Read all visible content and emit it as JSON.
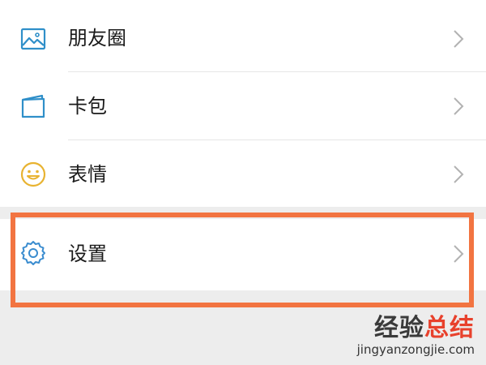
{
  "menu": {
    "items": [
      {
        "label": "朋友圈",
        "icon": "moments-picture-icon"
      },
      {
        "label": "卡包",
        "icon": "card-wallet-icon"
      },
      {
        "label": "表情",
        "icon": "smiley-emoji-icon"
      }
    ],
    "settings": {
      "label": "设置",
      "icon": "gear-icon"
    }
  },
  "highlight": {
    "color": "#f27441"
  },
  "watermark": {
    "logo_main": "经验",
    "logo_accent": "总结",
    "url": "jingyanzongjie.com"
  },
  "colors": {
    "icon_blue": "#2f8fc9",
    "icon_yellow": "#e8b331",
    "icon_settings_blue": "#3a8ccf",
    "background": "#ededed"
  }
}
